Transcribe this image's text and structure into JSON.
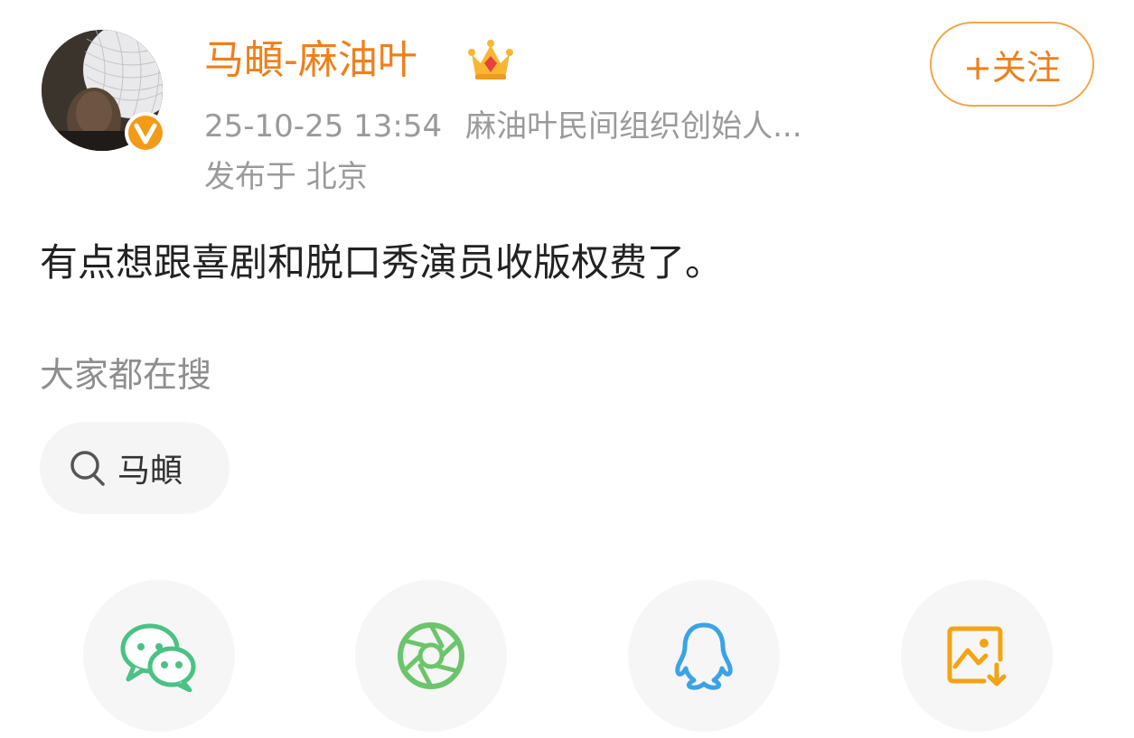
{
  "post": {
    "username": "马頔-麻油叶",
    "follow_label": "+关注",
    "timestamp": "25-10-25 13:54",
    "source": "麻油叶民间组织创始人...",
    "location": "发布于 北京",
    "text": "有点想跟喜剧和脱口秀演员收版权费了。"
  },
  "search": {
    "heading": "大家都在搜",
    "chip_label": "马頔"
  },
  "share": {
    "items": [
      {
        "icon": "wechat-icon"
      },
      {
        "icon": "moments-icon"
      },
      {
        "icon": "qq-icon"
      },
      {
        "icon": "save-image-icon"
      }
    ]
  },
  "colors": {
    "accent": "#ef7f1a",
    "wechat": "#4cc185",
    "moments": "#6bc56b",
    "qq": "#3aa3e6",
    "save": "#f3a313"
  }
}
